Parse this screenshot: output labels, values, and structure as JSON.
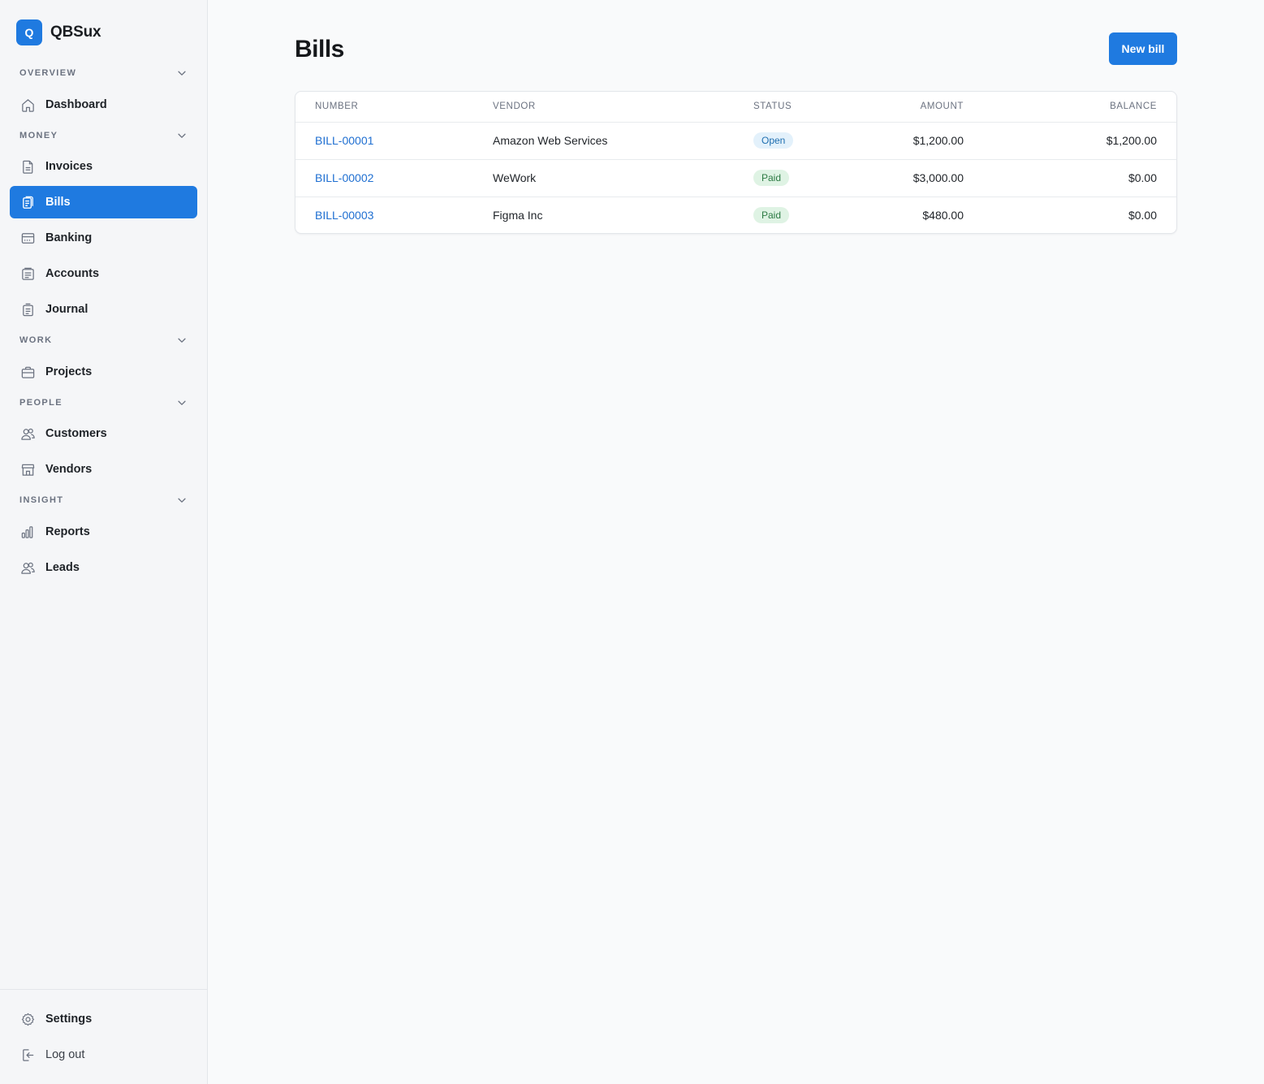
{
  "app": {
    "logo_letter": "Q",
    "name": "QBSux"
  },
  "sidebar": {
    "sections": [
      {
        "label": "OVERVIEW",
        "items": [
          {
            "label": "Dashboard",
            "icon": "home-icon"
          }
        ]
      },
      {
        "label": "MONEY",
        "items": [
          {
            "label": "Invoices",
            "icon": "document-icon"
          },
          {
            "label": "Bills",
            "icon": "clipboard-icon",
            "active": true
          },
          {
            "label": "Banking",
            "icon": "bank-card-icon"
          },
          {
            "label": "Accounts",
            "icon": "ledger-icon"
          },
          {
            "label": "Journal",
            "icon": "receipt-icon"
          }
        ]
      },
      {
        "label": "WORK",
        "items": [
          {
            "label": "Projects",
            "icon": "briefcase-icon"
          }
        ]
      },
      {
        "label": "PEOPLE",
        "items": [
          {
            "label": "Customers",
            "icon": "users-icon"
          },
          {
            "label": "Vendors",
            "icon": "storefront-icon"
          }
        ]
      },
      {
        "label": "INSIGHT",
        "items": [
          {
            "label": "Reports",
            "icon": "bar-chart-icon"
          },
          {
            "label": "Leads",
            "icon": "users-icon"
          }
        ]
      }
    ],
    "footer": {
      "settings_label": "Settings",
      "logout_label": "Log out"
    }
  },
  "main": {
    "title": "Bills",
    "new_button_label": "New bill",
    "table": {
      "columns": [
        "NUMBER",
        "VENDOR",
        "STATUS",
        "AMOUNT",
        "BALANCE"
      ],
      "rows": [
        {
          "number": "BILL-00001",
          "vendor": "Amazon Web Services",
          "status": "Open",
          "amount": "$1,200.00",
          "balance": "$1,200.00"
        },
        {
          "number": "BILL-00002",
          "vendor": "WeWork",
          "status": "Paid",
          "amount": "$3,000.00",
          "balance": "$0.00"
        },
        {
          "number": "BILL-00003",
          "vendor": "Figma Inc",
          "status": "Paid",
          "amount": "$480.00",
          "balance": "$0.00"
        }
      ]
    }
  },
  "colors": {
    "accent": "#1f7ae0",
    "link": "#1f6fd1",
    "status_open_bg": "#e3f1fb",
    "status_paid_bg": "#dff3e4"
  }
}
